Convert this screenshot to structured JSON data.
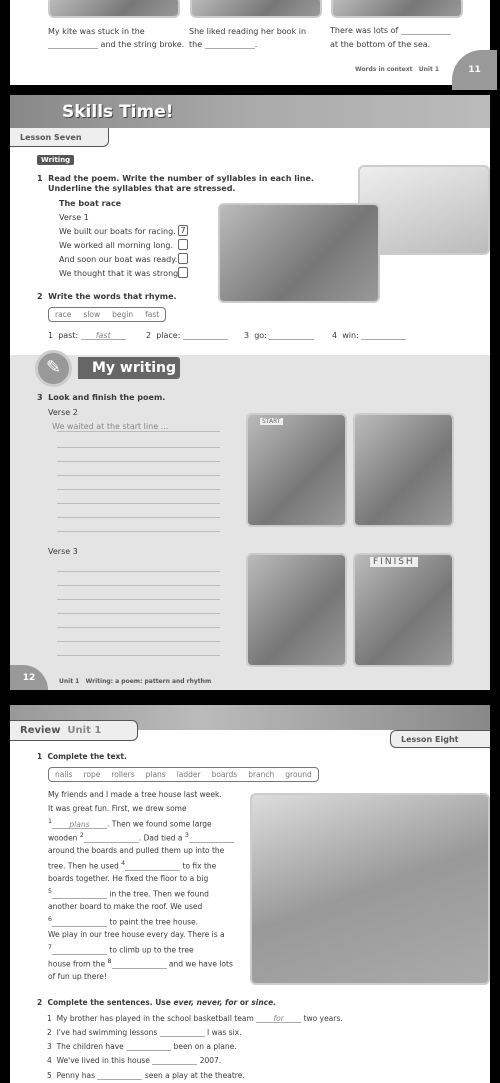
{
  "page11": {
    "captions": [
      [
        "My kite was stuck in the",
        "and the string broke."
      ],
      [
        "She liked reading her book in",
        "the",
        "."
      ],
      [
        "There was lots of",
        "at the bottom of the sea."
      ]
    ],
    "footer": "Words in context",
    "unit": "Unit 1",
    "page_number": "11"
  },
  "page12": {
    "header": "Skills Time!",
    "lesson": "Lesson Seven",
    "badge": "Writing",
    "q1": {
      "num": "1",
      "text": [
        "Read the poem. Write the number of syllables in each line.",
        "Underline the syllables that are stressed."
      ],
      "title": "The boat race",
      "verse": "Verse 1",
      "lines": [
        "We built our boats for racing.",
        "We worked all morning long.",
        "And soon our boat was ready.",
        "We thought that it was strong."
      ],
      "answers": [
        "7",
        "",
        "",
        ""
      ]
    },
    "q2": {
      "num": "2",
      "text": "Write the words that rhyme.",
      "words": [
        "race",
        "slow",
        "begin",
        "fast"
      ],
      "items": [
        {
          "n": "1",
          "w": "past:",
          "a": "fast"
        },
        {
          "n": "2",
          "w": "place:",
          "a": ""
        },
        {
          "n": "3",
          "w": "go:",
          "a": ""
        },
        {
          "n": "4",
          "w": "win:",
          "a": ""
        }
      ]
    },
    "my_writing": "My writing",
    "q3": {
      "num": "3",
      "text": "Look and finish the poem.",
      "verse2": "Verse 2",
      "example": "We waited at the start line ...",
      "verse3": "Verse 3"
    },
    "sign_start": "START",
    "sign_finish": "FINISH",
    "page_number": "12",
    "footer_unit": "Unit 1",
    "footer_text": "Writing: a poem: pattern and rhythm"
  },
  "page13": {
    "review": "Review",
    "unit": "Unit 1",
    "lesson": "Lesson Eight",
    "q1": {
      "num": "1",
      "text": "Complete the text.",
      "words": [
        "nails",
        "rope",
        "rollers",
        "plans",
        "ladder",
        "boards",
        "branch",
        "ground"
      ],
      "para": [
        "My friends and I made a tree house last week.",
        "It was great fun. First, we drew some"
      ],
      "example": "plans",
      "rows": [
        [
          "1",
          "plans",
          ". Then we found some large"
        ],
        [
          "wooden",
          "2",
          "",
          ". Dad tied a",
          "3",
          ""
        ],
        [
          "around the boards and pulled them up into the"
        ],
        [
          "tree. Then he used",
          "4",
          "",
          "to fix the"
        ],
        [
          "boards together. He fixed the floor to a big"
        ],
        [
          "5",
          "",
          "in the tree. Then we found"
        ],
        [
          "another board to make the roof. We used"
        ],
        [
          "6",
          "",
          "to paint the tree house."
        ],
        [
          "We play in our tree house every day. There is a"
        ],
        [
          "7",
          "",
          "to climb up to the tree"
        ],
        [
          "house from the",
          "8",
          "",
          "and we have lots"
        ],
        [
          "of fun up there!"
        ]
      ]
    },
    "q2": {
      "num": "2",
      "text": "Complete the sentences. Use",
      "words": "ever, never, for",
      "or": "or",
      "since": "since.",
      "items": [
        {
          "n": "1",
          "a": "My brother has played in the school basketball team",
          "ans": "for",
          "b": "two years."
        },
        {
          "n": "2",
          "a": "I've had swimming lessons",
          "ans": "",
          "b": "I was six."
        },
        {
          "n": "3",
          "a": "The children have",
          "ans": "",
          "b": "been on a plane."
        },
        {
          "n": "4",
          "a": "We've lived in this house",
          "ans": "",
          "b": "2007."
        },
        {
          "n": "5",
          "a": "Penny has",
          "ans": "",
          "b": "seen a play at the theatre."
        }
      ]
    }
  }
}
